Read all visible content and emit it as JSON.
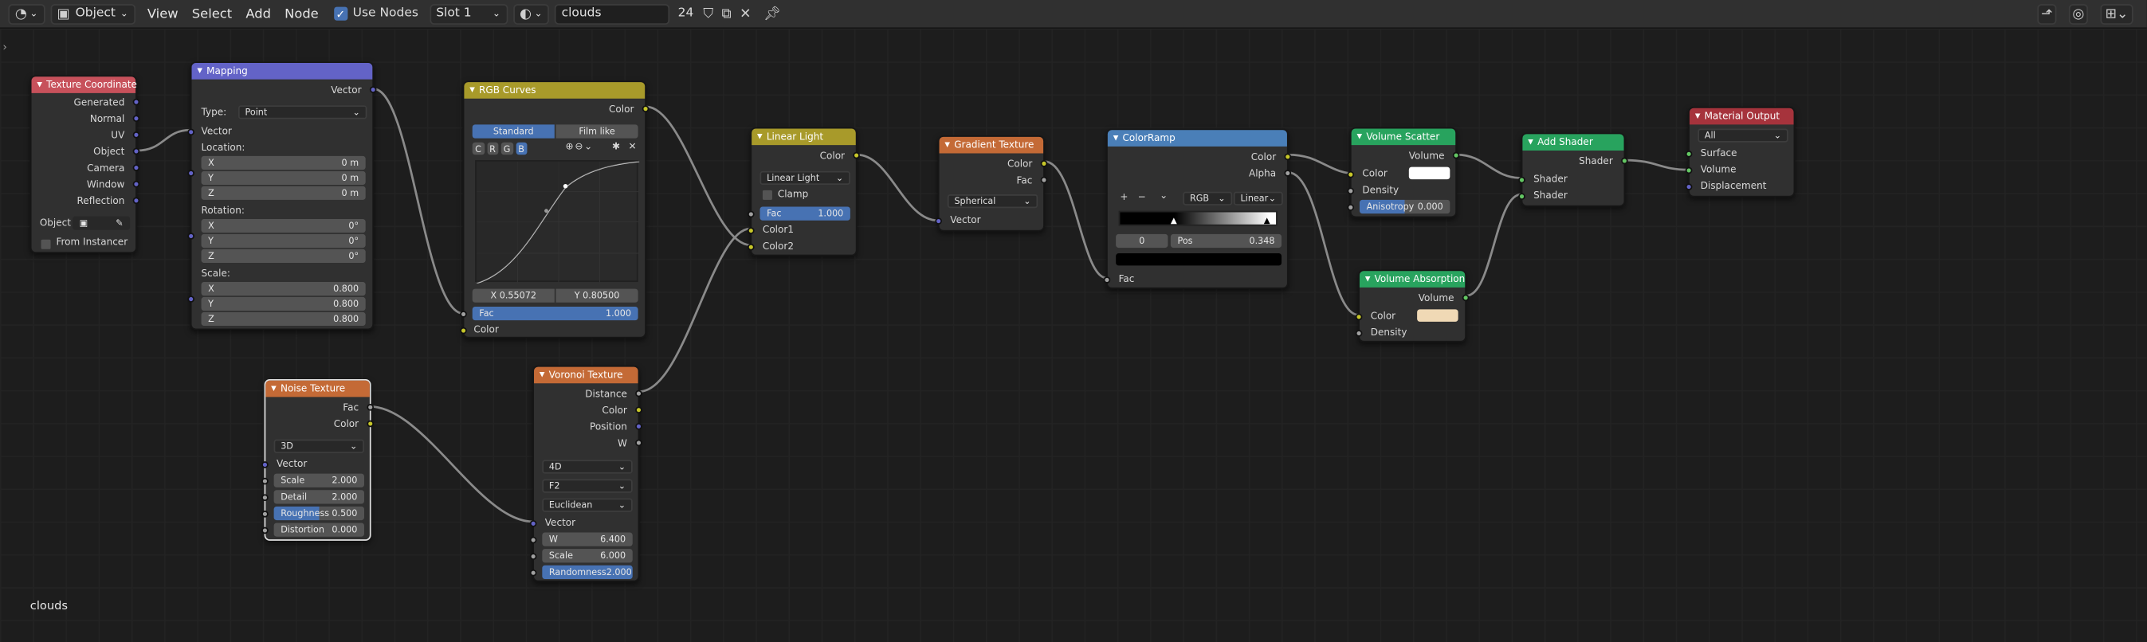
{
  "header": {
    "mode": "Object",
    "menus": [
      "View",
      "Select",
      "Add",
      "Node"
    ],
    "use_nodes_label": "Use Nodes",
    "slot": "Slot 1",
    "material_name": "clouds",
    "user_count": "24"
  },
  "footer": {
    "material": "clouds"
  },
  "nodes": {
    "tex_coord": {
      "title": "Texture Coordinate",
      "outputs": [
        "Generated",
        "Normal",
        "UV",
        "Object",
        "Camera",
        "Window",
        "Reflection"
      ],
      "object_label": "Object",
      "from_instancer": "From Instancer"
    },
    "mapping": {
      "title": "Mapping",
      "output": "Vector",
      "type_label": "Type:",
      "type_value": "Point",
      "vector_label": "Vector",
      "location": "Location:",
      "rotation": "Rotation:",
      "scale": "Scale:",
      "loc": [
        {
          "k": "X",
          "v": "0 m"
        },
        {
          "k": "Y",
          "v": "0 m"
        },
        {
          "k": "Z",
          "v": "0 m"
        }
      ],
      "rot": [
        {
          "k": "X",
          "v": "0°"
        },
        {
          "k": "Y",
          "v": "0°"
        },
        {
          "k": "Z",
          "v": "0°"
        }
      ],
      "scl": [
        {
          "k": "X",
          "v": "0.800"
        },
        {
          "k": "Y",
          "v": "0.800"
        },
        {
          "k": "Z",
          "v": "0.800"
        }
      ]
    },
    "rgb_curves": {
      "title": "RGB Curves",
      "output": "Color",
      "tab_standard": "Standard",
      "tab_film": "Film like",
      "channels": [
        "C",
        "R",
        "G",
        "B"
      ],
      "x_readout": "X 0.55072",
      "y_readout": "Y 0.80500",
      "fac_label": "Fac",
      "fac_value": "1.000",
      "color_label": "Color"
    },
    "linear_light": {
      "title": "Linear Light",
      "output": "Color",
      "blend": "Linear Light",
      "clamp": "Clamp",
      "fac_label": "Fac",
      "fac_value": "1.000",
      "color1": "Color1",
      "color2": "Color2"
    },
    "gradient": {
      "title": "Gradient Texture",
      "out_color": "Color",
      "out_fac": "Fac",
      "type": "Spherical",
      "vector": "Vector"
    },
    "colorramp": {
      "title": "ColorRamp",
      "out_color": "Color",
      "out_alpha": "Alpha",
      "mode": "RGB",
      "interp": "Linear",
      "index": "0",
      "pos_label": "Pos",
      "pos_value": "0.348",
      "fac": "Fac",
      "buttons": [
        "+",
        "−",
        "⌄"
      ]
    },
    "vol_scatter": {
      "title": "Volume Scatter",
      "output": "Volume",
      "color": "Color",
      "density": "Density",
      "aniso_label": "Anisotropy",
      "aniso_value": "0.000"
    },
    "add_shader": {
      "title": "Add Shader",
      "output": "Shader",
      "in1": "Shader",
      "in2": "Shader"
    },
    "mat_output": {
      "title": "Material Output",
      "target": "All",
      "surface": "Surface",
      "volume": "Volume",
      "displacement": "Displacement"
    },
    "vol_absorb": {
      "title": "Volume Absorption",
      "output": "Volume",
      "color": "Color",
      "density": "Density"
    },
    "noise": {
      "title": "Noise Texture",
      "out_fac": "Fac",
      "out_color": "Color",
      "dim": "3D",
      "vector": "Vector",
      "fields": [
        {
          "k": "Scale",
          "v": "2.000"
        },
        {
          "k": "Detail",
          "v": "2.000"
        },
        {
          "k": "Roughness",
          "v": "0.500"
        },
        {
          "k": "Distortion",
          "v": "0.000"
        }
      ]
    },
    "voronoi": {
      "title": "Voronoi Texture",
      "outputs": [
        "Distance",
        "Color",
        "Position",
        "W"
      ],
      "dim": "4D",
      "feature": "F2",
      "metric": "Euclidean",
      "vector": "Vector",
      "fields": [
        {
          "k": "W",
          "v": "6.400"
        },
        {
          "k": "Scale",
          "v": "6.000"
        },
        {
          "k": "Randomness",
          "v": "2.000"
        }
      ]
    }
  },
  "colors": {
    "input": "#c7515b",
    "vector": "#6363c7",
    "color": "#c7c729",
    "converter": "#4a7fb8",
    "texture": "#c46a36",
    "shader": "#28a35e",
    "output": "#a6333c"
  }
}
